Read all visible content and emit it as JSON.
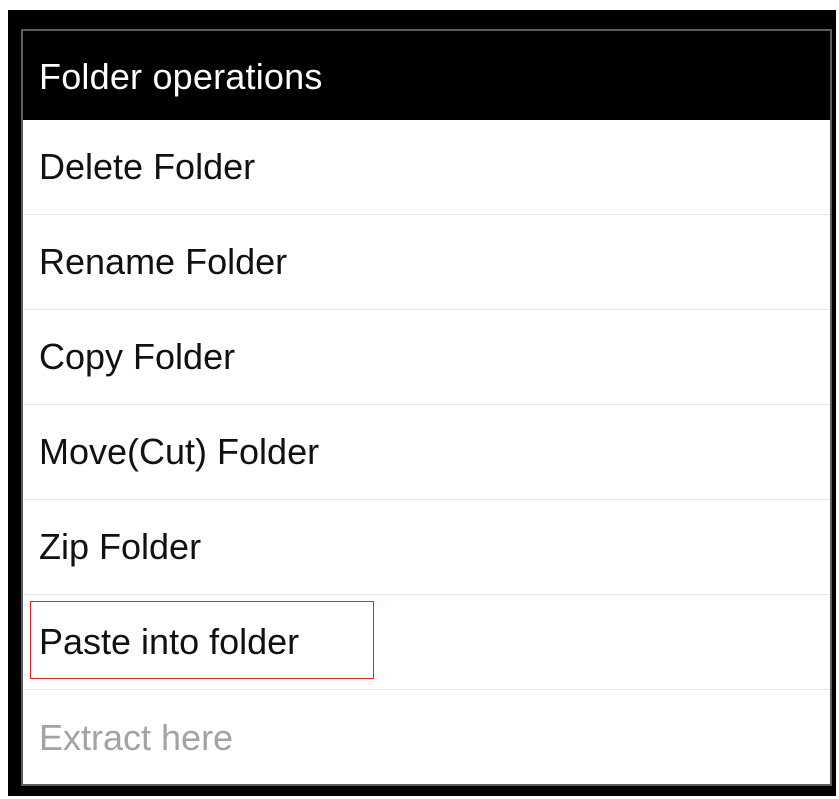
{
  "dialog": {
    "title": "Folder operations",
    "items": [
      {
        "label": "Delete Folder",
        "enabled": true
      },
      {
        "label": "Rename Folder",
        "enabled": true
      },
      {
        "label": "Copy Folder",
        "enabled": true
      },
      {
        "label": "Move(Cut) Folder",
        "enabled": true
      },
      {
        "label": "Zip Folder",
        "enabled": true
      },
      {
        "label": "Paste into folder",
        "enabled": true,
        "highlighted": true
      },
      {
        "label": "Extract here",
        "enabled": false
      }
    ]
  },
  "colors": {
    "header_background": "#000000",
    "header_text": "#ffffff",
    "item_text": "#111111",
    "disabled_text": "#a3a3a3",
    "highlight_border": "#e2232a"
  }
}
